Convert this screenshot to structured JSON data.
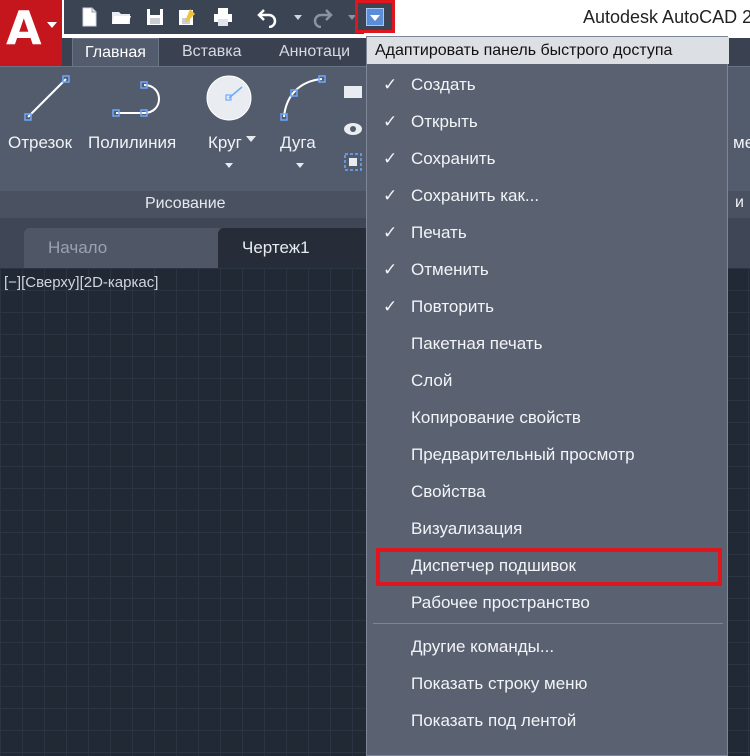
{
  "window": {
    "title": "Autodesk AutoCAD 2"
  },
  "app_button": {
    "letter": "A"
  },
  "qat": {
    "icons": [
      "new-icon",
      "open-icon",
      "save-icon",
      "save-as-icon",
      "print-icon",
      "undo-icon",
      "redo-icon"
    ],
    "customize_icon": "dropdown-arrow-icon"
  },
  "ribbon": {
    "tabs": [
      {
        "label": "Главная",
        "active": true
      },
      {
        "label": "Вставка",
        "active": false
      },
      {
        "label": "Аннотаци",
        "active": false
      }
    ],
    "tools": [
      {
        "label": "Отрезок",
        "icon": "line-icon"
      },
      {
        "label": "Полилиния",
        "icon": "polyline-icon"
      },
      {
        "label": "Круг",
        "icon": "circle-icon"
      },
      {
        "label": "Дуга",
        "icon": "arc-icon"
      }
    ],
    "right_partial_label": "мер",
    "right_partial_label2": "и",
    "panel_label": "Рисование"
  },
  "file_tabs": [
    {
      "label": "Начало",
      "active": false
    },
    {
      "label": "Чертеж1",
      "active": true
    }
  ],
  "viewport": {
    "label": "[−][Сверху][2D-каркас]"
  },
  "menu": {
    "title": "Адаптировать панель быстрого доступа",
    "items": [
      {
        "label": "Создать",
        "checked": true
      },
      {
        "label": "Открыть",
        "checked": true
      },
      {
        "label": "Сохранить",
        "checked": true
      },
      {
        "label": "Сохранить как...",
        "checked": true
      },
      {
        "label": "Печать",
        "checked": true
      },
      {
        "label": "Отменить",
        "checked": true
      },
      {
        "label": "Повторить",
        "checked": true
      },
      {
        "label": "Пакетная печать",
        "checked": false
      },
      {
        "label": "Слой",
        "checked": false
      },
      {
        "label": "Копирование свойств",
        "checked": false
      },
      {
        "label": "Предварительный просмотр",
        "checked": false
      },
      {
        "label": "Свойства",
        "checked": false
      },
      {
        "label": "Визуализация",
        "checked": false
      },
      {
        "label": "Диспетчер подшивок",
        "checked": false
      },
      {
        "label": "Рабочее пространство",
        "checked": false
      }
    ],
    "extra_items": [
      {
        "label": "Другие команды..."
      },
      {
        "label": "Показать строку меню"
      },
      {
        "label": "Показать под лентой"
      }
    ],
    "check_glyph": "✓"
  },
  "colors": {
    "highlight": "#e0161f",
    "brand": "#c4161c"
  }
}
